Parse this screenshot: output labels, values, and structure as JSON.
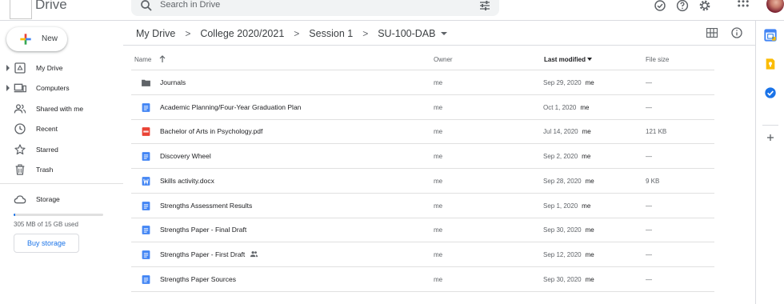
{
  "header": {
    "app_title": "Drive",
    "search_placeholder": "Search in Drive",
    "icons": [
      "support-icon",
      "help-icon",
      "settings-icon",
      "apps-grid-icon"
    ]
  },
  "sidebar": {
    "new_label": "New",
    "items": [
      {
        "label": "My Drive",
        "icon": "my-drive-icon",
        "expandable": true
      },
      {
        "label": "Computers",
        "icon": "computers-icon",
        "expandable": true
      },
      {
        "label": "Shared with me",
        "icon": "shared-with-me-icon",
        "expandable": false
      },
      {
        "label": "Recent",
        "icon": "recent-icon",
        "expandable": false
      },
      {
        "label": "Starred",
        "icon": "starred-icon",
        "expandable": false
      },
      {
        "label": "Trash",
        "icon": "trash-icon",
        "expandable": false
      },
      {
        "label": "Storage",
        "icon": "storage-cloud-icon",
        "expandable": false
      }
    ],
    "storage_used_text": "305 MB of 15 GB used",
    "storage_used_fraction": 0.02,
    "buy_storage_label": "Buy storage"
  },
  "breadcrumb": [
    "My Drive",
    "College 2020/2021",
    "Session 1",
    "SU-100-DAB"
  ],
  "columns": {
    "name": "Name",
    "owner": "Owner",
    "last_modified": "Last modified",
    "file_size": "File size"
  },
  "files": [
    {
      "name": "Journals",
      "type": "folder",
      "owner": "me",
      "modified": "Sep 29, 2020",
      "modified_by": "me",
      "size": "—",
      "shared": false
    },
    {
      "name": "Academic Planning/Four-Year Graduation Plan",
      "type": "doc",
      "owner": "me",
      "modified": "Oct 1, 2020",
      "modified_by": "me",
      "size": "—",
      "shared": false
    },
    {
      "name": "Bachelor of Arts in Psychology.pdf",
      "type": "pdf",
      "owner": "me",
      "modified": "Jul 14, 2020",
      "modified_by": "me",
      "size": "121 KB",
      "shared": false
    },
    {
      "name": "Discovery Wheel",
      "type": "doc",
      "owner": "me",
      "modified": "Sep 2, 2020",
      "modified_by": "me",
      "size": "—",
      "shared": false
    },
    {
      "name": "Skills activity.docx",
      "type": "word",
      "owner": "me",
      "modified": "Sep 28, 2020",
      "modified_by": "me",
      "size": "9 KB",
      "shared": false
    },
    {
      "name": "Strengths Assessment Results",
      "type": "doc",
      "owner": "me",
      "modified": "Sep 1, 2020",
      "modified_by": "me",
      "size": "—",
      "shared": false
    },
    {
      "name": "Strengths Paper - Final Draft",
      "type": "doc",
      "owner": "me",
      "modified": "Sep 30, 2020",
      "modified_by": "me",
      "size": "—",
      "shared": false
    },
    {
      "name": "Strengths Paper - First Draft",
      "type": "doc",
      "owner": "me",
      "modified": "Sep 12, 2020",
      "modified_by": "me",
      "size": "—",
      "shared": true
    },
    {
      "name": "Strengths Paper Sources",
      "type": "doc",
      "owner": "me",
      "modified": "Sep 30, 2020",
      "modified_by": "me",
      "size": "—",
      "shared": false
    }
  ],
  "side_panel": [
    "calendar-icon",
    "keep-icon",
    "tasks-icon",
    "add-addon-icon"
  ],
  "colors": {
    "accent": "#1a73e8",
    "doc_blue": "#4285f4",
    "pdf_red": "#ea4335",
    "folder_gray": "#5f6368",
    "keep_yellow": "#fbbc04"
  }
}
